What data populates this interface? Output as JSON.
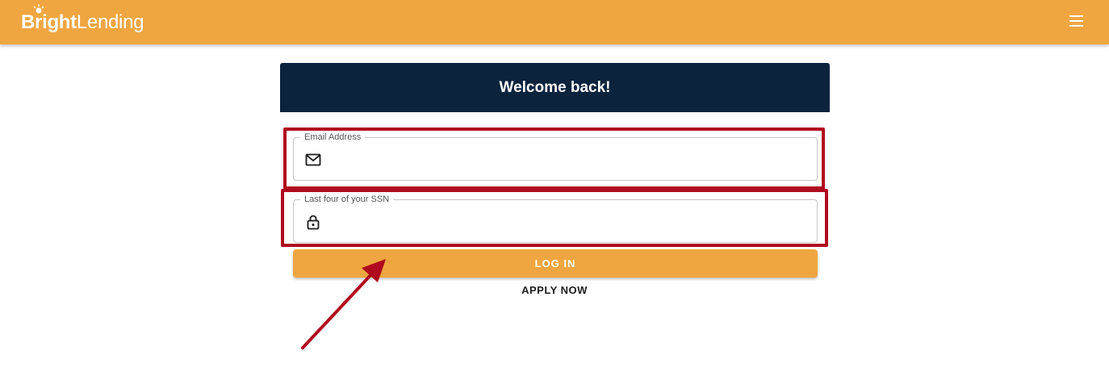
{
  "header": {
    "logo_bold": "Bright",
    "logo_light": "Lending",
    "menu_icon": "hamburger-menu-icon",
    "background_color": "#f0a640"
  },
  "card": {
    "title": "Welcome back!",
    "header_color": "#0b233d"
  },
  "form": {
    "email": {
      "label": "Email Address",
      "value": "",
      "icon": "mail-icon"
    },
    "ssn": {
      "label": "Last four of your SSN",
      "value": "",
      "icon": "lock-icon"
    },
    "login_label": "LOG IN",
    "apply_label": "APPLY NOW"
  },
  "annotations": {
    "highlight_color": "#b00b1e",
    "arrow_icon": "annotation-arrow-icon"
  }
}
